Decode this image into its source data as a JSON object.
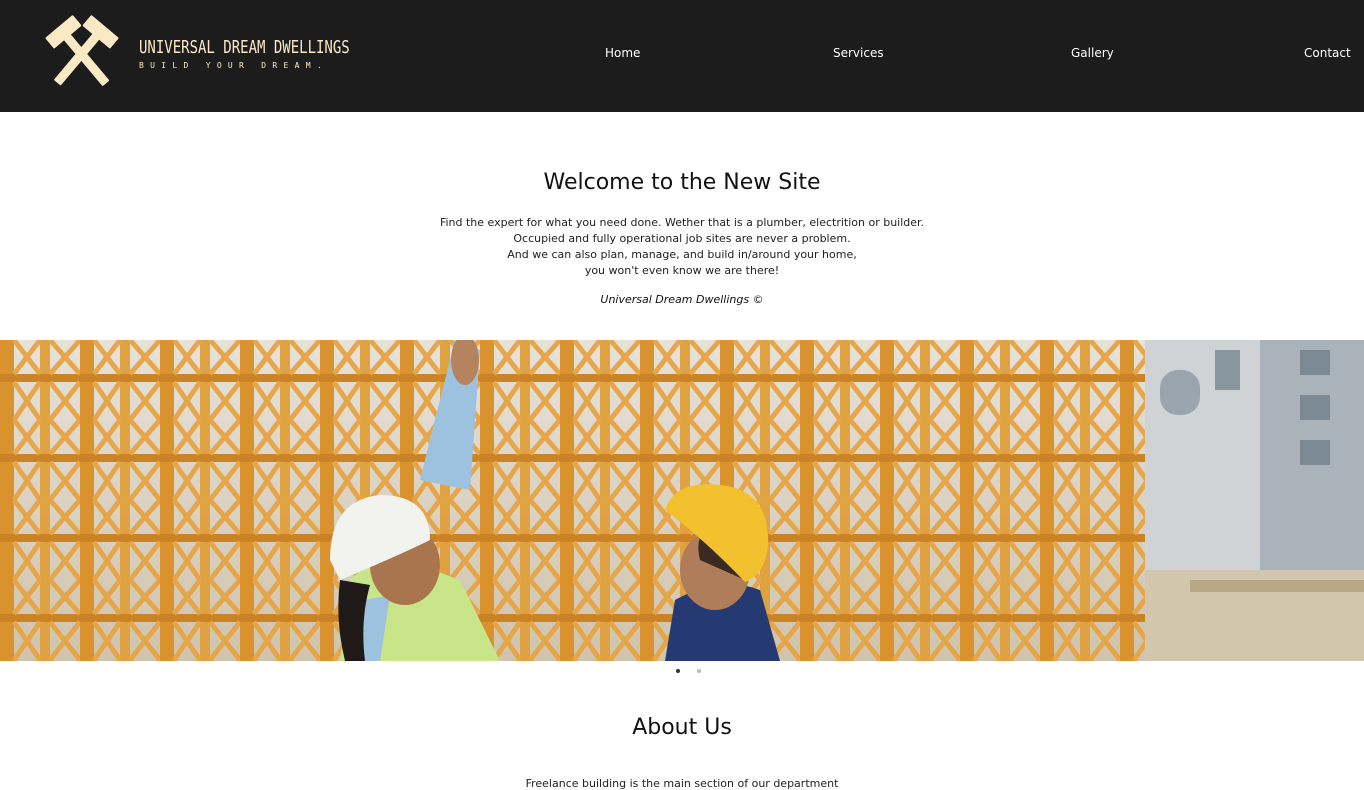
{
  "brand": {
    "name": "UNIVERSAL DREAM DWELLINGS",
    "tagline": "BUILD YOUR DREAM."
  },
  "nav": {
    "home": "Home",
    "services": "Services",
    "gallery": "Gallery",
    "contact": "Contact"
  },
  "welcome": {
    "title": "Welcome to the New Site",
    "lines": [
      "Find the expert for what you need done. Wether that is a plumber, electrition or builder.",
      "Occupied and fully operational job sites are never a problem.",
      "And we can also plan, manage, and build in/around your home,",
      "you won't even know we are there!"
    ],
    "signature": "Universal Dream Dwellings ©"
  },
  "hero": {
    "slide_count": 2,
    "active_slide": 1
  },
  "about": {
    "title": "About Us",
    "text": "Freelance building is the main section of our department"
  },
  "colors": {
    "header_bg": "#1c1c1c",
    "logo_cream": "#fbe9c6",
    "scaffold_orange": "#d98f25"
  },
  "icons": {
    "logo": "crossed-hammers-icon"
  }
}
